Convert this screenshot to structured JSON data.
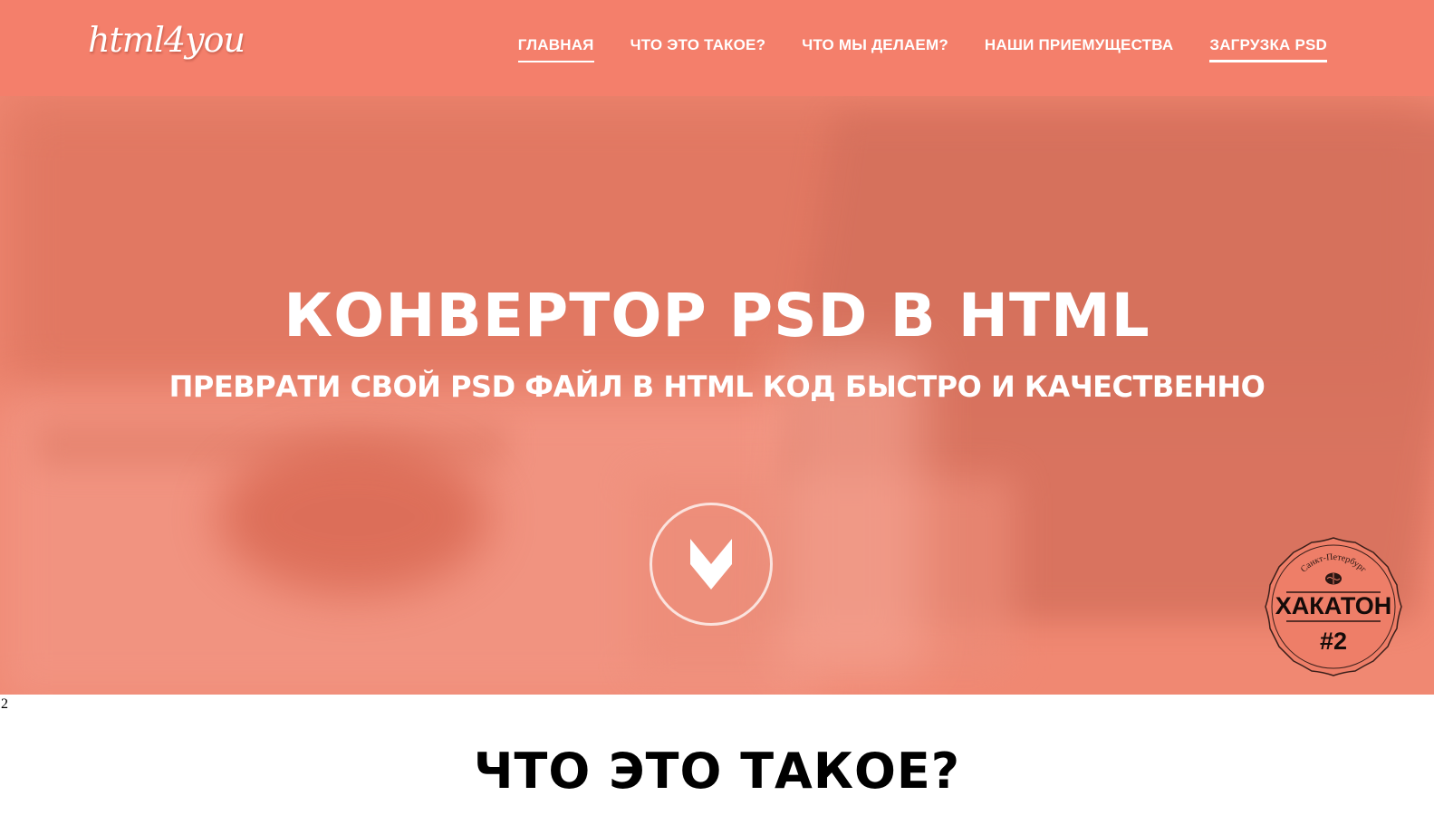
{
  "header": {
    "logo": "html4you",
    "nav": [
      {
        "label": "ГЛАВНАЯ"
      },
      {
        "label": "ЧТО ЭТО ТАКОЕ?"
      },
      {
        "label": "ЧТО МЫ ДЕЛАЕМ?"
      },
      {
        "label": "НАШИ ПРИЕМУЩЕСТВА"
      },
      {
        "label": "ЗАГРУЗКА PSD"
      }
    ]
  },
  "hero": {
    "title": "КОНВЕРТОР PSD В HTML",
    "subtitle": "ПРЕВРАТИ СВОЙ PSD ФАЙЛ В HTML КОД БЫСТРО И КАЧЕСТВЕННО",
    "scroll_icon": "chevron-down-icon"
  },
  "badge": {
    "city": "Санкт-Петербург",
    "title": "ХАКАТОН",
    "number": "#2"
  },
  "page_number": "2",
  "section": {
    "title": "ЧТО ЭТО ТАКОЕ?"
  },
  "colors": {
    "header": "#f47f6b",
    "hero": "#f08872",
    "text": "#ffffff"
  }
}
